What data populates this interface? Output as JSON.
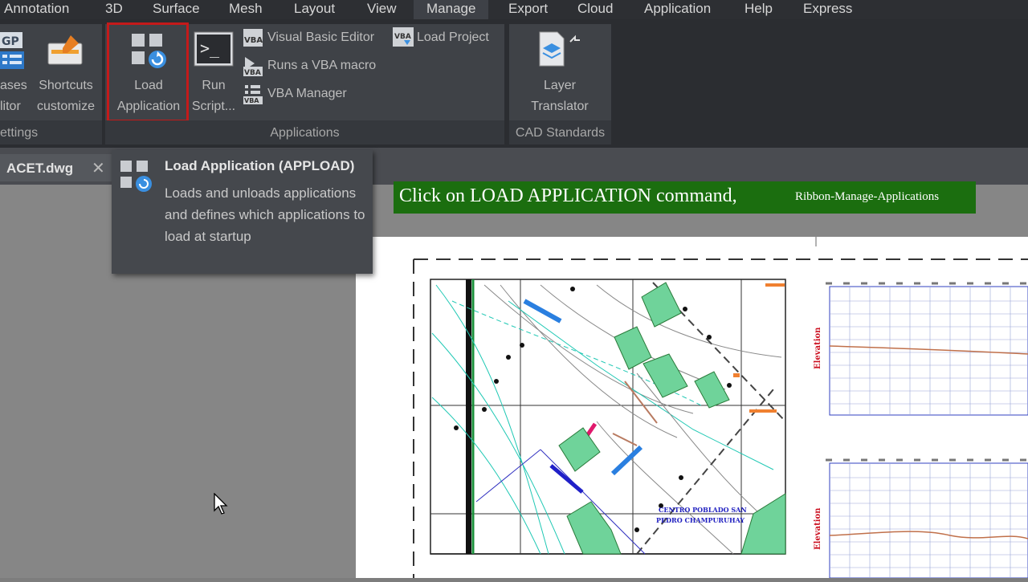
{
  "ribbon_tabs": [
    "Annotation",
    "3D",
    "Surface",
    "Mesh",
    "Layout",
    "View",
    "Manage",
    "Export",
    "Cloud",
    "Application",
    "Help",
    "Express"
  ],
  "active_tab": "Manage",
  "customize_panel": {
    "partial_button": {
      "line1": "ases",
      "line2": "litor"
    },
    "shortcuts_button": {
      "line1": "Shortcuts",
      "line2": "customize"
    },
    "title": "ettings"
  },
  "applications_panel": {
    "load_application": {
      "line1": "Load",
      "line2": "Application"
    },
    "run_script": {
      "line1": "Run",
      "line2": "Script..."
    },
    "visual_basic_editor": "Visual Basic Editor",
    "run_vba_macro": "Runs a VBA macro",
    "vba_manager": "VBA Manager",
    "load_project": "Load Project",
    "title": "Applications"
  },
  "cad_standards_panel": {
    "layer_translator": {
      "line1": "Layer",
      "line2": "Translator"
    },
    "title": "CAD Standards"
  },
  "file_tab": {
    "name": "ACET.dwg",
    "close": "✕"
  },
  "tooltip": {
    "title": "Load Application (APPLOAD)",
    "description": "Loads and unloads applications and defines which applications to load at startup"
  },
  "caption": {
    "main": "Click on LOAD APPLICATION command,",
    "sub": "Ribbon-Manage-Applications"
  },
  "drawing": {
    "label_line1": "CENTRO POBLADO SAN",
    "label_line2": "PEDRO CHAMPURUHAY",
    "profile_axis_label": "Elevation"
  },
  "colors": {
    "highlight": "#c41a1a",
    "caption_bg": "#1b6e0f",
    "ribbon_bg": "#2b2d31",
    "panel_bg": "#3f4247"
  }
}
